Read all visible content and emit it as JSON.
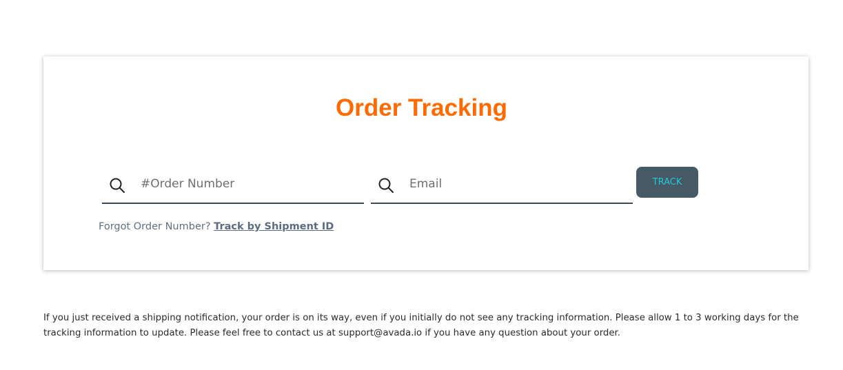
{
  "tracking": {
    "title": "Order Tracking",
    "order_field": {
      "placeholder": "#Order Number",
      "icon": "search-icon"
    },
    "email_field": {
      "placeholder": "Email",
      "icon": "search-icon"
    },
    "track_label": "TRACK",
    "forgot_text": "Forgot Order Number? ",
    "shipment_link": "Track by Shipment ID"
  },
  "note": "If you just received a shipping notification, your order is on its way, even if you initially do not see any tracking information. Please allow 1 to 3 working days for the tracking information to update. Please feel free to contact us at support@avada.io if you have any question about your order.",
  "colors": {
    "title": "#ff6b00",
    "button_bg": "#455a64",
    "button_text": "#26c6da",
    "link": "#5b6c80"
  }
}
